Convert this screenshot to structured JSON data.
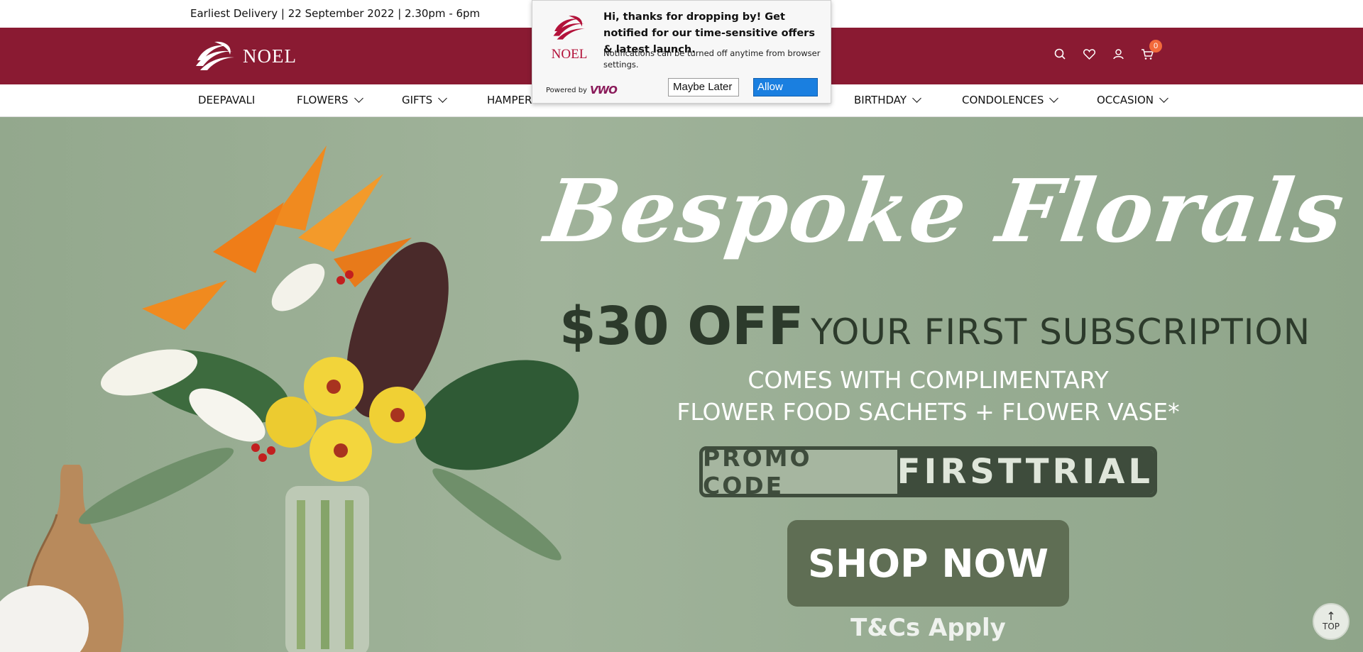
{
  "topbar": {
    "delivery_text": "Earliest Delivery | 22 September 2022 | 2.30pm - 6pm"
  },
  "header": {
    "logo_text": "NOEL",
    "icons": [
      "search-icon",
      "heart-icon",
      "user-icon",
      "cart-icon"
    ],
    "cart_count": "0",
    "colors": {
      "header_bg": "#8a1a32",
      "badge": "#f26a3b"
    }
  },
  "nav": {
    "items": [
      {
        "label": "DEEPAVALI",
        "dropdown": false
      },
      {
        "label": "FLOWERS",
        "dropdown": true
      },
      {
        "label": "GIFTS",
        "dropdown": true
      },
      {
        "label": "HAMPER",
        "dropdown": false
      },
      {
        "label": "BIRTHDAY",
        "dropdown": true
      },
      {
        "label": "CONDOLENCES",
        "dropdown": true
      },
      {
        "label": "OCCASION",
        "dropdown": true
      }
    ]
  },
  "hero": {
    "script_title": "Bespoke Florals",
    "offer_big": "$30 OFF",
    "offer_rest": "YOUR FIRST SUBSCRIPTION",
    "comes_line1": "COMES WITH COMPLIMENTARY",
    "comes_line2": "FLOWER FOOD SACHETS + FLOWER VASE*",
    "promo_label": "PROMO CODE",
    "promo_code": "FIRSTTRIAL",
    "shop_now": "SHOP NOW",
    "tcs": "T&Cs Apply"
  },
  "top_button": {
    "label": "TOP"
  },
  "popup": {
    "logo_text": "NOEL",
    "title": "Hi, thanks for dropping by! Get notified for our time-sensitive offers & latest launch.",
    "subtitle": "Notifications can be turned off anytime from browser settings.",
    "powered_by": "Powered by",
    "powered_brand": "VWO",
    "maybe_later": "Maybe Later",
    "allow": "Allow"
  }
}
